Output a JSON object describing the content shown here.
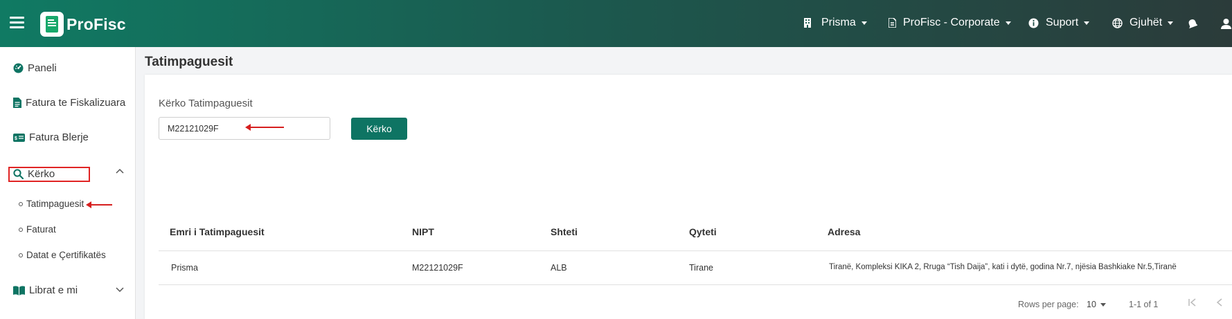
{
  "header": {
    "app_name": "ProFisc",
    "nav": [
      {
        "label": "Prisma",
        "icon": "building-icon"
      },
      {
        "label": "ProFisc - Corporate",
        "icon": "file-icon"
      },
      {
        "label": "Suport",
        "icon": "info-icon"
      },
      {
        "label": "Gjuhët",
        "icon": "globe-icon"
      }
    ]
  },
  "sidebar": {
    "items": [
      {
        "label": "Paneli",
        "icon": "dashboard-icon"
      },
      {
        "label": "Fatura te Fiskalizuara",
        "icon": "document-icon"
      },
      {
        "label": "Fatura Blerje",
        "icon": "cash-icon"
      },
      {
        "label": "Kërko",
        "icon": "search-icon"
      },
      {
        "label": "Librat e mi",
        "icon": "book-icon"
      }
    ],
    "sub_items": [
      {
        "label": "Tatimpaguesit"
      },
      {
        "label": "Faturat"
      },
      {
        "label": "Datat e Çertifikatës"
      }
    ]
  },
  "main": {
    "page_title": "Tatimpaguesit",
    "search": {
      "label": "Kërko Tatimpaguesit",
      "value": "M22121029F",
      "button_label": "Kërko"
    },
    "table": {
      "columns": [
        "Emri i Tatimpaguesit",
        "NIPT",
        "Shteti",
        "Qyteti",
        "Adresa"
      ],
      "rows": [
        [
          "Prisma",
          "M22121029F",
          "ALB",
          "Tirane",
          "Tiranë, Kompleksi KIKA 2, Rruga “Tish Daija”, kati i dytë, godina Nr.7, njësia Bashkiake Nr.5,Tiranë"
        ]
      ]
    },
    "pagination": {
      "rows_per_page_label": "Rows per page:",
      "rows_per_page_value": "10",
      "range": "1-1 of 1"
    }
  },
  "colors": {
    "header_start": "#107a63",
    "header_end": "#2b3b3a",
    "accent": "#0e7463",
    "annotation_red": "#d61f1f"
  }
}
